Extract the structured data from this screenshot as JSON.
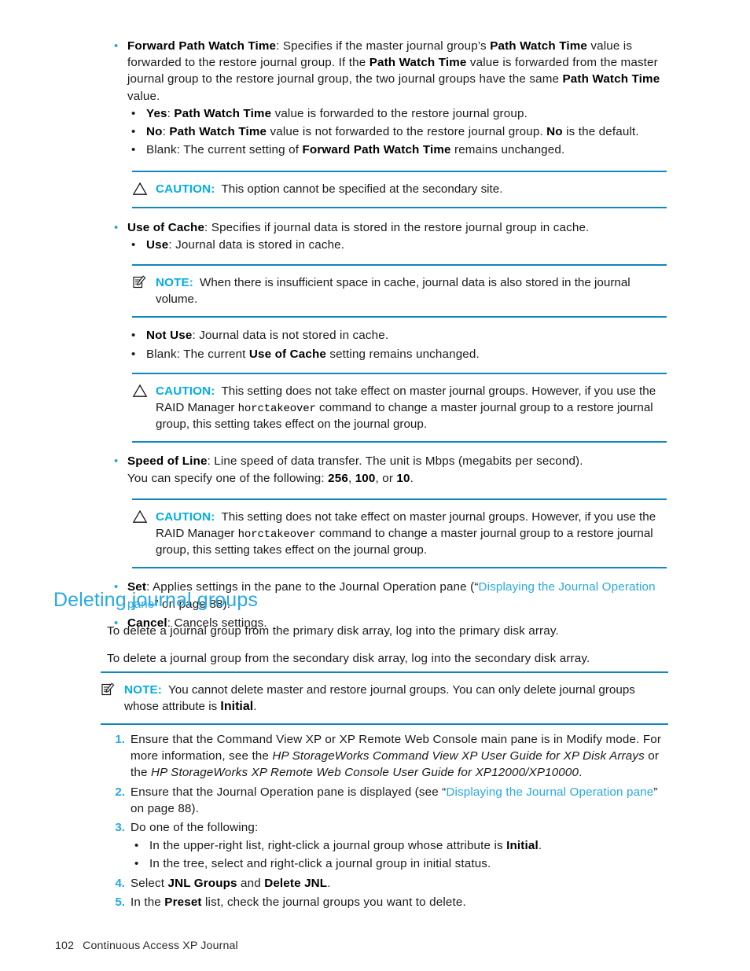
{
  "page": {
    "number": "102",
    "footer_title": "Continuous Access XP Journal",
    "accent_cyan": "#27A9E1",
    "accent_label": "#00AEE5",
    "rule_blue": "#1386BE"
  },
  "bullets": {
    "forward_path": {
      "term": "Forward Path Watch Time",
      "line1_a": ": Specifies if the master journal group’s ",
      "term2": "Path Watch Time",
      "line1_b": " value is forwarded to the restore journal group. If the ",
      "term3": "Path Watch Time",
      "line1_c": " value is forwarded from the master journal group to the restore journal group, the two journal groups have the same ",
      "term4": "Path Watch Time",
      "line1_d": " value.",
      "sub": [
        {
          "term": "Yes",
          "sep": ": ",
          "term_b": "Path Watch Time",
          "text": " value is forwarded to the restore journal group."
        },
        {
          "term": "No",
          "sep": ": ",
          "term_b": "Path Watch Time",
          "text": " value is not forwarded to the restore journal group. ",
          "term_c": "No",
          "text_c": " is the default."
        },
        {
          "term": "Blank",
          "sep": ": The current setting of ",
          "term_b": "Forward Path Watch Time",
          "text": " remains unchanged."
        }
      ]
    },
    "use_of_cache": {
      "term": "Use of Cache",
      "text": ": Specifies if journal data is stored in the restore journal group in cache.",
      "sub_use": {
        "term": "Use",
        "text": ": Journal data is stored in cache."
      },
      "sub_not_use": {
        "term": "Not Use",
        "text": ": Journal data is not stored in cache."
      },
      "sub_blank": {
        "pre": "Blank: The current ",
        "term": "Use of Cache",
        "post": " setting remains unchanged."
      }
    },
    "speed_of_line": {
      "term": "Speed of Line",
      "text": ": Line speed of data transfer. The unit is Mbps (megabits per second).",
      "line2_pre": "You can specify one of the following: ",
      "v1": "256",
      "sep1": ", ",
      "v2": "100",
      "sep2": ", or ",
      "v3": "10",
      "end": "."
    },
    "set": {
      "term": "Set",
      "text_a": ": Applies settings in the pane to the Journal Operation pane (“",
      "link": "Displaying the Journal Operation pane",
      "text_b": "” on page 88)."
    },
    "cancel": {
      "term": "Cancel",
      "text": ": Cancels settings."
    }
  },
  "admonitions": {
    "caution1": {
      "label": "CAUTION:",
      "icon": "warning-triangle-icon",
      "body": "This option cannot be specified at the secondary site."
    },
    "note1": {
      "label": "NOTE:",
      "icon": "notepad-icon",
      "body": "When there is insufficient space in cache, journal data is also stored in the journal volume."
    },
    "caution2": {
      "label": "CAUTION:",
      "icon": "warning-triangle-icon",
      "body_a": "This setting does not take effect on master journal groups. However, if you use the RAID Manager ",
      "command": "horctakeover",
      "body_b": " command to change a master journal group to a restore journal group, this setting takes effect on the journal group."
    },
    "caution3": {
      "label": "CAUTION:",
      "icon": "warning-triangle-icon",
      "body_a": "This setting does not take effect on master journal groups. However, if you use the RAID Manager ",
      "command": "horctakeover",
      "body_b": " command to change a master journal group to a restore journal group, this setting takes effect on the journal group."
    },
    "note2": {
      "label": "NOTE:",
      "icon": "notepad-icon",
      "body_a": "You cannot delete master and restore journal groups. You can only delete journal groups whose attribute is ",
      "term": "Initial",
      "body_b": "."
    }
  },
  "section": {
    "heading": "Deleting journal groups",
    "para1": "To delete a journal group from the primary disk array, log into the primary disk array.",
    "para2": "To delete a journal group from the secondary disk array, log into the secondary disk array."
  },
  "steps": {
    "s1": {
      "num": "1.",
      "text_a": "Ensure that the Command View XP or XP Remote Web Console main pane is in Modify mode. For more information, see the ",
      "italic_a": "HP StorageWorks Command View XP User Guide for XP Disk Arrays",
      "text_b": " or the ",
      "italic_b": "HP StorageWorks XP Remote Web Console User Guide for XP12000/XP10000",
      "text_c": "."
    },
    "s2": {
      "num": "2.",
      "text_a": "Ensure that the Journal Operation pane is displayed (see “",
      "link": "Displaying the Journal Operation pane",
      "text_b": "” on page 88)."
    },
    "s3": {
      "num": "3.",
      "text": "Do one of the following:",
      "sub1_pre": "In the upper-right list, right-click a journal group whose attribute is ",
      "sub1_term": "Initial",
      "sub1_post": ".",
      "sub2": "In the tree, select and right-click a journal group in initial status."
    },
    "s4": {
      "num": "4.",
      "text_a": "Select ",
      "term_a": "JNL Groups",
      "text_b": " and ",
      "term_b": "Delete JNL",
      "text_c": "."
    },
    "s5": {
      "num": "5.",
      "text_a": "In the ",
      "term": "Preset",
      "text_b": " list, check the journal groups you want to delete."
    }
  },
  "glyphs": {
    "bullet": "•"
  }
}
